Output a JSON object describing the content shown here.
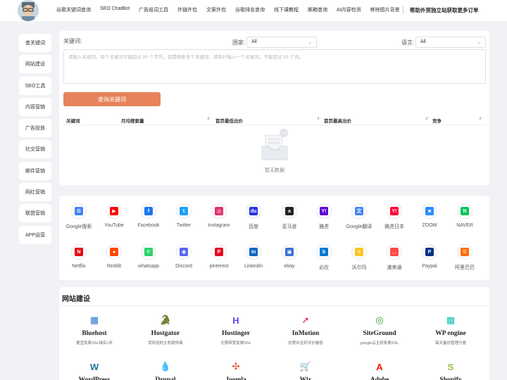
{
  "header": {
    "nav": [
      "谷歌关键词查询",
      "SEO ChatBot",
      "广告组词工具",
      "外链外包",
      "文案外包",
      "谷歌排名查询",
      "线下课教程",
      "邮箱查询",
      "AI内容检测",
      "移除图片背景"
    ],
    "cta": "帮助外贸独立站获取更多订单"
  },
  "sidebar": [
    "查关键词",
    "网站建设",
    "SEO工具",
    "内容营销",
    "广告投放",
    "社交营销",
    "邮件营销",
    "网红营销",
    "联盟营销",
    "APP运营"
  ],
  "search": {
    "keyword_label": "关键词:",
    "country_label": "国家:",
    "country_value": "All",
    "language_label": "语言:",
    "language_value": "All",
    "placeholder": "请输入关键词，每个关键词不能超过 80 个字符。如需搜索多个关键词，请每行输入一个关键词，不能超过 20 个词。",
    "button": "查询关键词",
    "columns": [
      "关键词",
      "月均搜索量",
      "首页最低出价",
      "首页最高出价",
      "竞争"
    ],
    "empty": "暂无数据"
  },
  "social": [
    {
      "name": "Google搜索",
      "icon": "google-icon",
      "color": "#4285f4",
      "glyph": "G"
    },
    {
      "name": "YouTube",
      "icon": "youtube-icon",
      "color": "#ff0000",
      "glyph": "▶"
    },
    {
      "name": "Facebook",
      "icon": "facebook-icon",
      "color": "#1877f2",
      "glyph": "f"
    },
    {
      "name": "Twitter",
      "icon": "twitter-icon",
      "color": "#1da1f2",
      "glyph": "t"
    },
    {
      "name": "instagram",
      "icon": "instagram-icon",
      "color": "#e1306c",
      "glyph": "◎"
    },
    {
      "name": "百度",
      "icon": "baidu-icon",
      "color": "#2932e1",
      "glyph": "du"
    },
    {
      "name": "亚马逊",
      "icon": "amazon-icon",
      "color": "#222222",
      "glyph": "a"
    },
    {
      "name": "雅虎",
      "icon": "yahoo-icon",
      "color": "#6001d2",
      "glyph": "Y!"
    },
    {
      "name": "Google翻译",
      "icon": "google-translate-icon",
      "color": "#4285f4",
      "glyph": "文"
    },
    {
      "name": "雅虎日本",
      "icon": "yahoo-japan-icon",
      "color": "#ff0033",
      "glyph": "Y!"
    },
    {
      "name": "ZOOM",
      "icon": "zoom-icon",
      "color": "#2d8cff",
      "glyph": "■"
    },
    {
      "name": "NAVER",
      "icon": "naver-icon",
      "color": "#03c75a",
      "glyph": "N"
    },
    {
      "name": "Netflix",
      "icon": "netflix-icon",
      "color": "#e50914",
      "glyph": "N"
    },
    {
      "name": "Reddit",
      "icon": "reddit-icon",
      "color": "#ff4500",
      "glyph": "●"
    },
    {
      "name": "whatsapp",
      "icon": "whatsapp-icon",
      "color": "#25d366",
      "glyph": "✆"
    },
    {
      "name": "Discord",
      "icon": "discord-icon",
      "color": "#5865f2",
      "glyph": "◉"
    },
    {
      "name": "pinterest",
      "icon": "pinterest-icon",
      "color": "#e60023",
      "glyph": "P"
    },
    {
      "name": "Linkedin",
      "icon": "linkedin-icon",
      "color": "#0a66c2",
      "glyph": "in"
    },
    {
      "name": "ebay",
      "icon": "ebay-icon",
      "color": "#3a6fd6",
      "glyph": "▣"
    },
    {
      "name": "必应",
      "icon": "bing-icon",
      "color": "#0078d4",
      "glyph": "b"
    },
    {
      "name": "沃尔玛",
      "icon": "walmart-icon",
      "color": "#ffc220",
      "glyph": "✳"
    },
    {
      "name": "速卖通",
      "icon": "aliexpress-icon",
      "color": "#ff4747",
      "glyph": "◡"
    },
    {
      "name": "Paypal",
      "icon": "paypal-icon",
      "color": "#003087",
      "glyph": "P"
    },
    {
      "name": "阿里巴巴",
      "icon": "alibaba-icon",
      "color": "#ff6a00",
      "glyph": "☰"
    }
  ],
  "website": {
    "title": "网站建设",
    "items": [
      {
        "name": "Bluehost",
        "desc": "便宜免费SSL域名1年",
        "icon": "bluehost-icon",
        "color": "#2f6fd1",
        "glyph": "▦"
      },
      {
        "name": "Hostgator",
        "desc": "受欢迎的主机提供商",
        "icon": "hostgator-icon",
        "color": "#f2a23a",
        "glyph": "🐊"
      },
      {
        "name": "Hostinger",
        "desc": "无限带宽免费SSL",
        "icon": "hostinger-icon",
        "color": "#673de6",
        "glyph": "H"
      },
      {
        "name": "InMotion",
        "desc": "优质并且好评价格低",
        "icon": "inmotion-icon",
        "color": "#d6203a",
        "glyph": "➚"
      },
      {
        "name": "SiteGround",
        "desc": "google云主机免费SSL",
        "icon": "siteground-icon",
        "color": "#2a9a3b",
        "glyph": "◎"
      },
      {
        "name": "WP engine",
        "desc": "每天备份管理方便",
        "icon": "wpengine-icon",
        "color": "#19bcb6",
        "glyph": "▩"
      },
      {
        "name": "WordPress",
        "desc": "",
        "icon": "wordpress-icon",
        "color": "#21759b",
        "glyph": "W"
      },
      {
        "name": "Drupal",
        "desc": "",
        "icon": "drupal-icon",
        "color": "#0678be",
        "glyph": "💧"
      },
      {
        "name": "Joomla",
        "desc": "",
        "icon": "joomla-icon",
        "color": "#f44321",
        "glyph": "✣"
      },
      {
        "name": "Wix",
        "desc": "",
        "icon": "wix-icon",
        "color": "#2aa4e0",
        "glyph": "🛒"
      },
      {
        "name": "Adobe",
        "desc": "",
        "icon": "adobe-icon",
        "color": "#fa0f00",
        "glyph": "A"
      },
      {
        "name": "Shopify",
        "desc": "",
        "icon": "shopify-icon",
        "color": "#95bf47",
        "glyph": "S"
      }
    ]
  }
}
